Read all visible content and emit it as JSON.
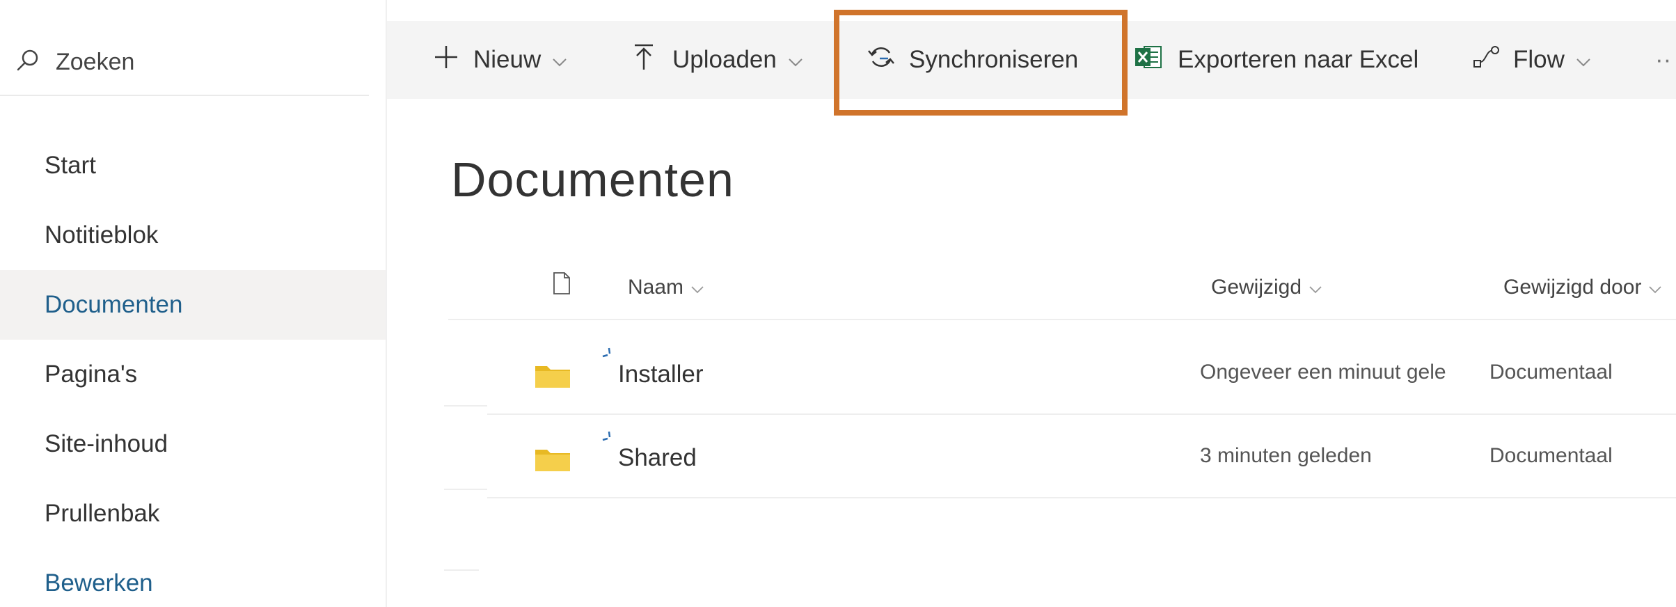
{
  "search": {
    "label": "Zoeken"
  },
  "nav": {
    "items": [
      {
        "label": "Start"
      },
      {
        "label": "Notitieblok"
      },
      {
        "label": "Documenten"
      },
      {
        "label": "Pagina's"
      },
      {
        "label": "Site-inhoud"
      },
      {
        "label": "Prullenbak"
      },
      {
        "label": "Bewerken"
      }
    ],
    "active": "Documenten"
  },
  "toolbar": {
    "new_label": "Nieuw",
    "upload_label": "Uploaden",
    "sync_label": "Synchroniseren",
    "export_label": "Exporteren naar Excel",
    "flow_label": "Flow",
    "more_label": "··"
  },
  "library": {
    "title": "Documenten"
  },
  "columns": {
    "name": "Naam",
    "modified": "Gewijzigd",
    "modified_by": "Gewijzigd door"
  },
  "files": [
    {
      "name": "Installer",
      "modified": "Ongeveer een minuut gele",
      "modified_by": "Documentaal"
    },
    {
      "name": "Shared",
      "modified": "3 minuten geleden",
      "modified_by": "Documentaal"
    }
  ],
  "colors": {
    "accent": "#1f5f8b",
    "highlight": "#d0742b",
    "folder": "#f0c33c",
    "excel": "#1e7145",
    "sync_icon": "#2b6cb0"
  }
}
